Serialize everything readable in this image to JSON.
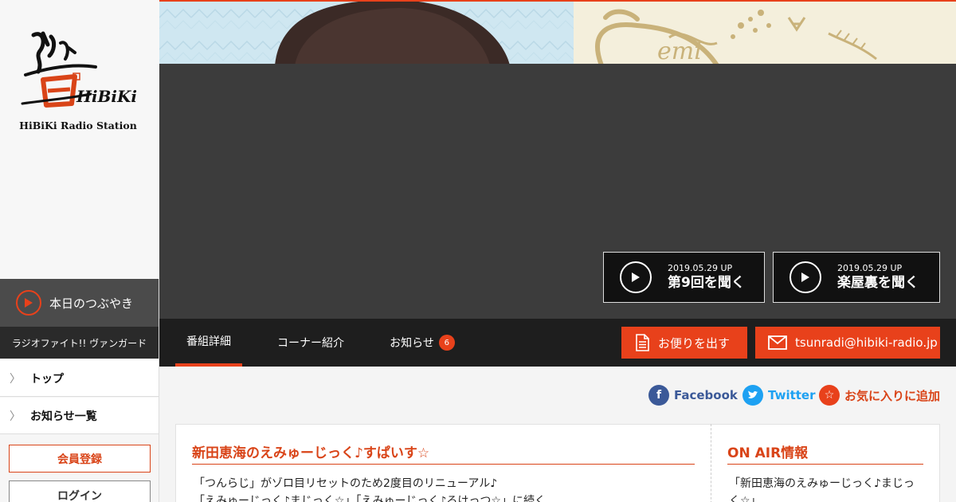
{
  "brand": {
    "logo_text": "響 HiBiKi",
    "station_name": "HiBiKi Radio Station"
  },
  "sidebar": {
    "tsubuyaki_label": "本日のつぶやき",
    "vanguard_label": "ラジオファイト!! ヴァンガード",
    "items": [
      {
        "label": "トップ"
      },
      {
        "label": "お知らせ一覧"
      }
    ],
    "register_label": "会員登録",
    "login_label": "ログイン"
  },
  "hero": {
    "banner_text": "emi",
    "episodes": [
      {
        "date": "2019.05.29 UP",
        "title": "第9回を聞く"
      },
      {
        "date": "2019.05.29 UP",
        "title": "楽屋裏を聞く"
      }
    ]
  },
  "tabs": [
    {
      "label": "番組詳細",
      "active": true
    },
    {
      "label": "コーナー紹介",
      "active": false
    },
    {
      "label": "お知らせ",
      "active": false,
      "badge": "6"
    }
  ],
  "actions": {
    "letter_label": "お便りを出す",
    "email_label": "tsunradi@hibiki-radio.jp"
  },
  "social": {
    "facebook_label": "Facebook",
    "twitter_label": "Twitter",
    "favorite_label": "お気に入りに追加"
  },
  "program": {
    "title": "新田恵海のえみゅーじっく♪すぱいす☆",
    "description_line1": "「つんらじ」がゾロ目リセットのため2度目のリニューアル♪",
    "description_line2": "「えみゅーじっく♪まじっく☆」「えみゅーじっく♪ろけっつ☆」に続く"
  },
  "onair": {
    "title": "ON AIR情報",
    "text": "「新田恵海のえみゅーじっく♪まじっく☆」"
  },
  "colors": {
    "accent": "#e8411b",
    "dark": "#1e1e1e",
    "hero_gray": "#3c3c3c",
    "facebook": "#3b5998",
    "twitter": "#1da1f2"
  }
}
